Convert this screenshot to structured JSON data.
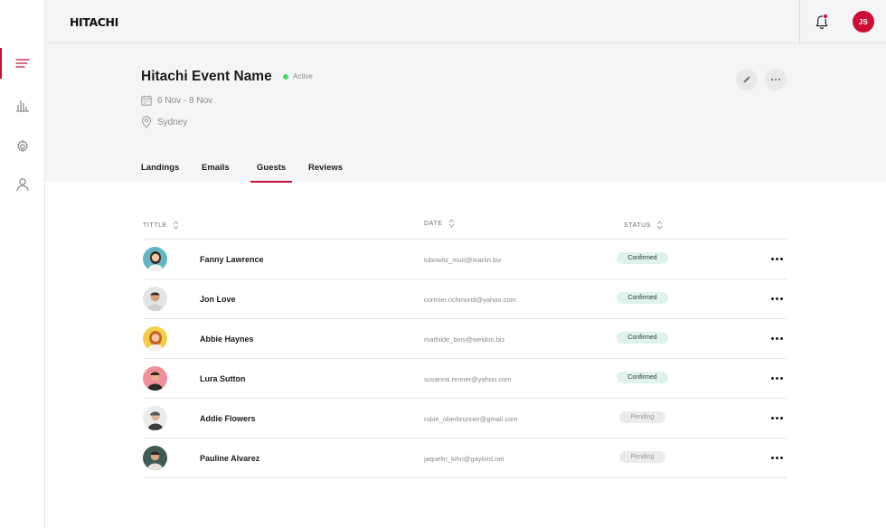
{
  "brand": {
    "logo": "HITACHI",
    "accent": "#cc0e35"
  },
  "header": {
    "user_initials": "JS"
  },
  "sidebar": {
    "items": [
      {
        "icon": "list-icon",
        "active": true
      },
      {
        "icon": "bar-chart-icon",
        "active": false
      },
      {
        "icon": "gear-icon",
        "active": false
      },
      {
        "icon": "user-icon",
        "active": false
      }
    ]
  },
  "event": {
    "title": "Hitachi Event Name",
    "status": "Active",
    "dates": "6 Nov - 8 Nov",
    "location": "Sydney"
  },
  "tabs": [
    {
      "label": "Landings",
      "active": false
    },
    {
      "label": "Emails",
      "active": false
    },
    {
      "label": "Guests",
      "active": true
    },
    {
      "label": "Reviews",
      "active": false
    }
  ],
  "table": {
    "columns": [
      "TITTLE",
      "DATE",
      "STATUS"
    ],
    "rows": [
      {
        "name": "Fanny Lawrence",
        "email": "lubowitz_murl@marlin.biz",
        "status": "Confirmed"
      },
      {
        "name": "Jon Love",
        "email": "cormier.richmond@yahoo.com",
        "status": "Confirmed"
      },
      {
        "name": "Abbie Haynes",
        "email": "mathilde_bins@weldon.biz",
        "status": "Confirmed"
      },
      {
        "name": "Lura Sutton",
        "email": "susanna.renner@yahoo.com",
        "status": "Confirmed"
      },
      {
        "name": "Addie Flowers",
        "email": "rubie_oberbrunner@gmail.com",
        "status": "Pending"
      },
      {
        "name": "Pauline Alvarez",
        "email": "jaquelin_kihn@gaylord.net",
        "status": "Pending"
      }
    ]
  }
}
